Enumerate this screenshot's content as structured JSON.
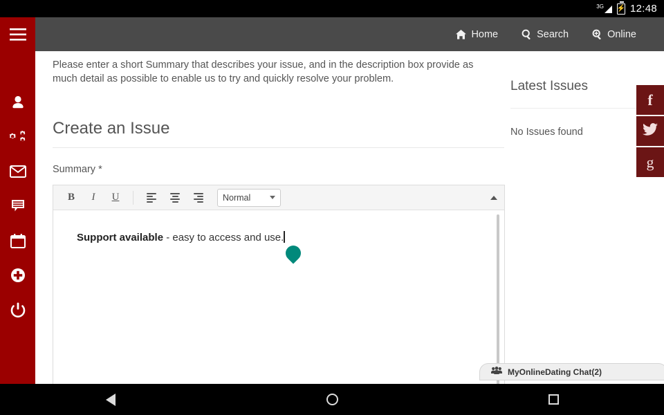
{
  "statusbar": {
    "network_label": "3G",
    "time": "12:48",
    "battery_icon": "battery-charging-icon",
    "signal_icon": "signal-bars-icon"
  },
  "sidebar": {
    "background_color": "#9b0000",
    "menu_icon": "hamburger-menu-icon",
    "items": [
      {
        "icon": "user-icon",
        "name": "profile"
      },
      {
        "icon": "gears-icon",
        "name": "settings"
      },
      {
        "icon": "envelope-icon",
        "name": "messages"
      },
      {
        "icon": "comment-list-icon",
        "name": "issues"
      },
      {
        "icon": "calendar-icon",
        "name": "calendar"
      },
      {
        "icon": "plus-circle-icon",
        "name": "new"
      },
      {
        "icon": "power-icon",
        "name": "logout"
      }
    ]
  },
  "topbar": {
    "background_color": "#4a4a4a",
    "nav": [
      {
        "label": "Home",
        "icon": "home-icon"
      },
      {
        "label": "Search",
        "icon": "search-icon"
      },
      {
        "label": "Online",
        "icon": "zoom-in-icon"
      }
    ]
  },
  "main": {
    "intro": "Please enter a short Summary that describes your issue, and in the description box provide as much detail as possible to enable us to try and quickly resolve your problem.",
    "page_title": "Create an Issue",
    "summary_label": "Summary *",
    "editor": {
      "toolbar": {
        "bold": "B",
        "italic": "I",
        "underline": "U",
        "align_left_icon": "align-left-icon",
        "align_center_icon": "align-center-icon",
        "align_right_icon": "align-right-icon",
        "style_value": "Normal",
        "style_options": [
          "Normal"
        ],
        "collapse_icon": "caret-up-icon"
      },
      "content_bold": "Support available",
      "content_rest": " - easy to access and use.",
      "handle_color": "#00897b",
      "handle_icon": "text-cursor-handle-icon"
    }
  },
  "rightcol": {
    "title": "Latest Issues",
    "empty_text": "No Issues found"
  },
  "social": {
    "background_color": "#6b1515",
    "items": [
      {
        "label": "f",
        "icon": "facebook-icon"
      },
      {
        "label": "",
        "icon": "twitter-icon"
      },
      {
        "label": "g",
        "icon": "google-plus-icon"
      }
    ]
  },
  "chat": {
    "label": "MyOnlineDating Chat(2)",
    "icon": "users-group-icon"
  },
  "navbar": {
    "back": "back-button",
    "home": "home-button",
    "recents": "recents-button"
  }
}
